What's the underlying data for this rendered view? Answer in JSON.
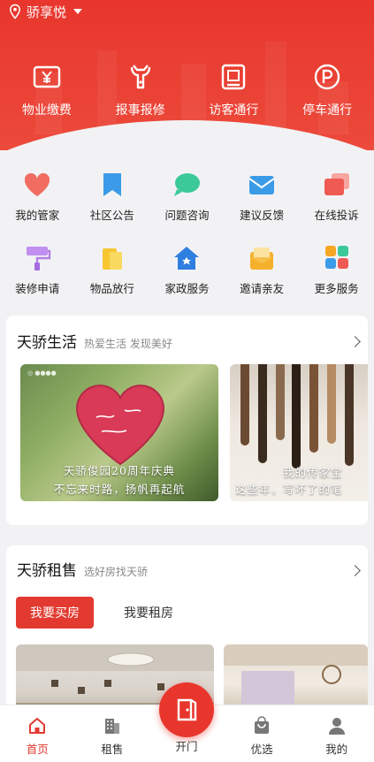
{
  "location": {
    "name": "骄享悦"
  },
  "top_nav": [
    {
      "label": "物业缴费",
      "icon": "wallet-yen-icon"
    },
    {
      "label": "报事报修",
      "icon": "wrench-icon"
    },
    {
      "label": "访客通行",
      "icon": "visitor-id-icon"
    },
    {
      "label": "停车通行",
      "icon": "parking-icon"
    }
  ],
  "services": [
    {
      "label": "我的管家",
      "icon": "heart-icon"
    },
    {
      "label": "社区公告",
      "icon": "bookmark-icon"
    },
    {
      "label": "问题咨询",
      "icon": "chat-bubble-icon"
    },
    {
      "label": "建议反馈",
      "icon": "mail-icon"
    },
    {
      "label": "在线投诉",
      "icon": "cards-icon"
    },
    {
      "label": "装修申请",
      "icon": "paint-roller-icon"
    },
    {
      "label": "物品放行",
      "icon": "package-icon"
    },
    {
      "label": "家政服务",
      "icon": "house-icon"
    },
    {
      "label": "邀请亲友",
      "icon": "envelope-open-icon"
    },
    {
      "label": "更多服务",
      "icon": "grid-icon"
    }
  ],
  "life_section": {
    "title": "天骄生活",
    "subtitle": "热爱生活  发现美好",
    "images": [
      {
        "caption_line1": "天骄俊园20周年庆典",
        "caption_line2": "不忘来时路，扬帆再起航"
      },
      {
        "caption_line1": "我的传家宝",
        "caption_line2": "这些年，写坏了的笔"
      }
    ]
  },
  "rent_section": {
    "title": "天骄租售",
    "subtitle": "选好房找天骄",
    "tab_buy": "我要买房",
    "tab_rent": "我要租房"
  },
  "bottom_nav": {
    "home": "首页",
    "rent_sale": "租售",
    "open_door": "开门",
    "preferred": "优选",
    "mine": "我的"
  },
  "colors": {
    "brand": "#e8362d",
    "accent_text": "#e23a30"
  }
}
